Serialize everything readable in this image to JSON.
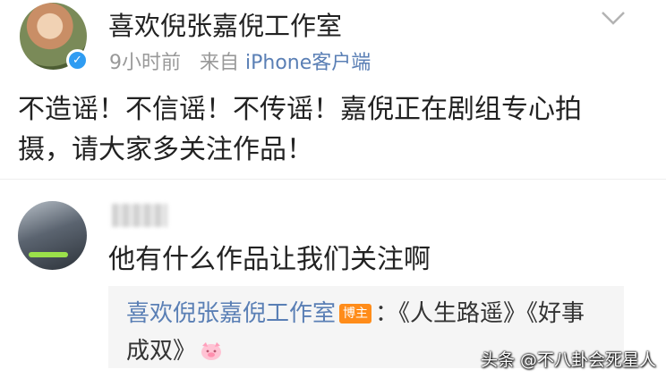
{
  "post": {
    "author": "喜欢倪张嘉倪工作室",
    "time": "9小时前",
    "source_prefix": "来自",
    "source_client": "iPhone客户端",
    "text": "不造谣！不信谣！不传谣！嘉倪正在剧组专心拍摄，请大家多关注作品！",
    "icons": {
      "verified": "verified-badge-icon",
      "menu": "chevron-down-icon"
    },
    "colors": {
      "verified": "#2f9cf2",
      "link": "#5a7fb5"
    }
  },
  "comment": {
    "text": "他有什么作品让我们关注啊"
  },
  "reply": {
    "author": "喜欢倪张嘉倪工作室",
    "badge": "博主",
    "line1": "：《人生路遥》《好事",
    "line2": "成双》",
    "emoji": "pig-face-icon",
    "badge_color": "#ff8c1a"
  },
  "watermark": "头条 @不八卦会死星人"
}
